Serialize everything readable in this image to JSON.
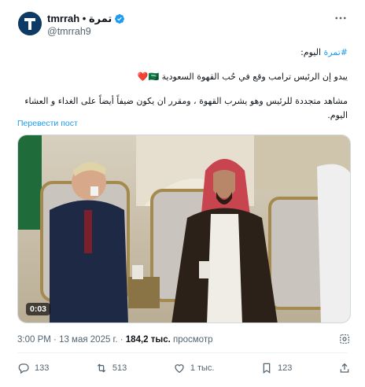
{
  "author": {
    "display_name": "tmrrah • تمرة",
    "handle": "@tmrrah9",
    "verified": true,
    "avatar_icon": "avatar-t-logo"
  },
  "menu_icon": "more-icon",
  "tweet": {
    "line1_prefix": "اليوم:",
    "line1_hashtag": "#تمرة",
    "line2": "يبدو إن الرئيس ترامب وقع في حُب القهوة السعودية 🇸🇦❤️",
    "line3": "مشاهد متجددة للرئيس وهو يشرب القهوة ، ومقرر ان يكون ضيفاً أيضاً على الغداء و العشاء اليوم."
  },
  "translate_label": "Перевести пост",
  "media": {
    "duration": "0:03"
  },
  "meta": {
    "time": "3:00 PM",
    "sep1": " · ",
    "date": "13 мая 2025 г.",
    "sep2": " · ",
    "views_count": "184,2 тыс.",
    "views_label": " просмотр"
  },
  "actions": {
    "replies": "133",
    "reposts": "513",
    "likes": "1 тыс.",
    "bookmarks": "123"
  },
  "colors": {
    "accent": "#1d9bf0",
    "secondary_text": "#536471"
  }
}
